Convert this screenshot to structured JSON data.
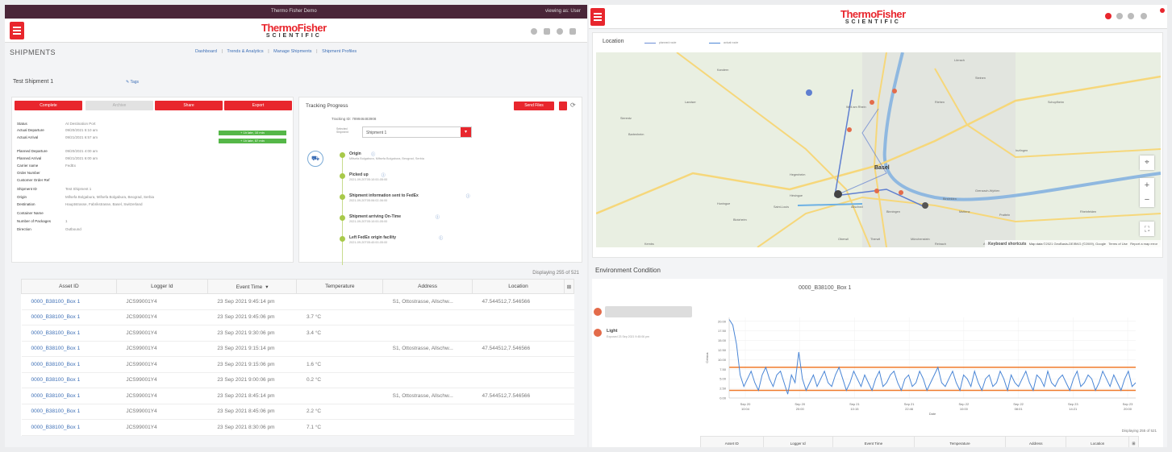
{
  "left": {
    "topbar": {
      "title": "Thermo Fisher Demo",
      "user": "viewing as: User"
    },
    "logo": {
      "line1": "ThermoFisher",
      "line2": "SCIENTIFIC"
    },
    "page_title": "SHIPMENTS",
    "nav": [
      "Dashboard",
      "Trends & Analytics",
      "Manage Shipments",
      "Shipment Profiles"
    ],
    "nav_separator": "|",
    "shipment_name": "Test Shipment 1",
    "tags_link": "Tags",
    "actions": {
      "complete": "Complete",
      "archive": "Archive",
      "share": "Share",
      "export": "Export"
    },
    "details": [
      {
        "label": "Status",
        "value": "At Destination Port"
      },
      {
        "label": "Actual Departure",
        "value": "09/20/2021 5:10 am"
      },
      {
        "label": "Actual Arrival",
        "value": "09/21/2021 6:57 am"
      },
      {
        "label": "Planned Departure",
        "value": "09/20/2021 4:00 am"
      },
      {
        "label": "Planned Arrival",
        "value": "09/21/2021 6:00 am"
      },
      {
        "label": "Carrier name",
        "value": "FedEx"
      },
      {
        "label": "Order Number",
        "value": ""
      },
      {
        "label": "Customer Order Ref",
        "value": ""
      },
      {
        "label": "Shipment ID",
        "value": "Test Shipment 1"
      },
      {
        "label": "Origin",
        "value": "Mifsefa Bolgabura, Mifsefa Bolgabura, Beograd, Serbia"
      },
      {
        "label": "Destination",
        "value": "Hauptstrasse, Fabrikstrasse, Basel, Switzerland"
      },
      {
        "label": "Container Name",
        "value": ""
      },
      {
        "label": "Number of Packages",
        "value": "1"
      },
      {
        "label": "Direction",
        "value": "Outbound"
      }
    ],
    "badges": [
      "+ 1h late, 10 min",
      "+ 1h late, 57 min"
    ],
    "tracking": {
      "title": "Tracking Progress",
      "send_button": "Send Files",
      "tracking_label": "Tracking ID:",
      "tracking_id": "789946483908",
      "select_label": "Selected Shipment",
      "select_value": "Shipment 1",
      "events": [
        {
          "title": "Origin",
          "sub": "Mifsefa Bolgabura, Mifsefa Bolgabura, Beograd, Serbia"
        },
        {
          "title": "Picked up",
          "sub": "2021-09-20T05:10:00-05:00"
        },
        {
          "title": "Shipment information sent to FedEx",
          "sub": "2021-09-20T05:06:02-06:00"
        },
        {
          "title": "Shipment arriving On-Time",
          "sub": "2021-09-20T05:10:00-05:00"
        },
        {
          "title": "Left FedEx origin facility",
          "sub": "2021-09-20T05:40:00-05:00"
        }
      ]
    },
    "displaying": "Displaying 255 of 521",
    "table": {
      "headers": [
        "Asset ID",
        "Logger Id",
        "Event Time",
        "Temperature",
        "Address",
        "Location"
      ],
      "sort_glyph": "▾",
      "rows": [
        [
          "0000_B38100_Box 1",
          "JCS99001Y4",
          "23 Sep 2021 9:45:14 pm",
          "",
          "S1, Ottostrasse, Allschw...",
          "47.544512,7.546566"
        ],
        [
          "0000_B38100_Box 1",
          "JCS99001Y4",
          "23 Sep 2021 9:45:06 pm",
          "3.7 °C",
          "",
          ""
        ],
        [
          "0000_B38100_Box 1",
          "JCS99001Y4",
          "23 Sep 2021 9:30:06 pm",
          "3.4 °C",
          "",
          ""
        ],
        [
          "0000_B38100_Box 1",
          "JCS99001Y4",
          "23 Sep 2021 9:15:14 pm",
          "",
          "S1, Ottostrasse, Allschw...",
          "47.544512,7.546566"
        ],
        [
          "0000_B38100_Box 1",
          "JCS99001Y4",
          "23 Sep 2021 9:15:06 pm",
          "1.6 °C",
          "",
          ""
        ],
        [
          "0000_B38100_Box 1",
          "JCS99001Y4",
          "23 Sep 2021 9:00:06 pm",
          "0.2 °C",
          "",
          ""
        ],
        [
          "0000_B38100_Box 1",
          "JCS99001Y4",
          "23 Sep 2021 8:45:14 pm",
          "",
          "S1, Ottostrasse, Allschw...",
          "47.544512,7.546566"
        ],
        [
          "0000_B38100_Box 1",
          "JCS99001Y4",
          "23 Sep 2021 8:45:06 pm",
          "2.2 °C",
          "",
          ""
        ],
        [
          "0000_B38100_Box 1",
          "JCS99001Y4",
          "23 Sep 2021 8:30:06 pm",
          "7.1 °C",
          "",
          ""
        ]
      ]
    }
  },
  "right": {
    "logo": {
      "line1": "ThermoFisher",
      "line2": "SCIENTIFIC"
    },
    "location_title": "Location",
    "legend": [
      "planned route",
      "actual route"
    ],
    "map": {
      "places": [
        "Basel",
        "Riehen",
        "Lörrach",
        "Weil am Rhein",
        "Binningen",
        "Allschwil",
        "Muttenz",
        "Pratteln",
        "Hegenheim",
        "Saint-Louis",
        "Huningue",
        "Kembs",
        "Rheinfelden",
        "Grenzach-Wyhlen",
        "Birsfelden",
        "Reinach",
        "Arlesheim",
        "Dornach",
        "Kandern",
        "Schopfheim",
        "Steinen",
        "Inzlingen",
        "Blotzheim",
        "Hésingue",
        "Bartenheim",
        "Sierentz",
        "Landser",
        "Oberwil",
        "Therwil",
        "Münchenstein"
      ],
      "footer": [
        "Keyboard shortcuts",
        "Map data ©2021 GeoBasis-DE/BKG (©2009), Google",
        "Terms of Use",
        "Report a map error"
      ],
      "controls": [
        "+",
        "−"
      ]
    },
    "env_title": "Environment Condition",
    "chart_title": "0000_B38100_Box 1",
    "light_label": "Light",
    "light_sub": "Exposed 23 Sep 2021 9:45:06 pm",
    "displaying": "Displaying 255 of 521",
    "table_headers": [
      "Asset ID",
      "Logger Id",
      "Event Time",
      "Temperature",
      "Address",
      "Location"
    ]
  },
  "chart_data": {
    "type": "line",
    "title": "0000_B38100_Box 1",
    "xlabel": "Date",
    "ylabel": "Celsius",
    "yticks": [
      "20.00",
      "17.50",
      "15.00",
      "12.50",
      "10.00",
      "7.50",
      "5.00",
      "2.50",
      "0.00"
    ],
    "xticks": [
      "Sep 20 10:04",
      "Sep 20 20:00",
      "Sep 21 10:15",
      "Sep 21 22:46",
      "Sep 22 10:00",
      "Sep 22 08:01",
      "Sep 23 14:21",
      "Sep 23 20:00"
    ],
    "ylim": [
      0,
      21
    ],
    "thresholds": [
      2,
      8
    ],
    "threshold_color": "#f07a2a",
    "series_color": "#4a86d6",
    "values": [
      20.5,
      19,
      14,
      6,
      3,
      5,
      7,
      4,
      2,
      6,
      8,
      5,
      3,
      6,
      7,
      4,
      1,
      6,
      4,
      12,
      5,
      2,
      4,
      6,
      3,
      5,
      7,
      4,
      3,
      6,
      8,
      5,
      2,
      4,
      7,
      5,
      3,
      6,
      4,
      2,
      5,
      7,
      3,
      4,
      6,
      7,
      4,
      2,
      5,
      6,
      3,
      4,
      7,
      5,
      2,
      4,
      6,
      8,
      4,
      3,
      5,
      7,
      4,
      2,
      6,
      5,
      3,
      7,
      4,
      2,
      5,
      6,
      3,
      4,
      7,
      5,
      2,
      6,
      4,
      3,
      5,
      7,
      4,
      2,
      6,
      5,
      3,
      7,
      4,
      3,
      5,
      6,
      4,
      2,
      5,
      7,
      3,
      4,
      6,
      5,
      2,
      4,
      7,
      5,
      3,
      6,
      4,
      2,
      5,
      7,
      3,
      4
    ]
  }
}
